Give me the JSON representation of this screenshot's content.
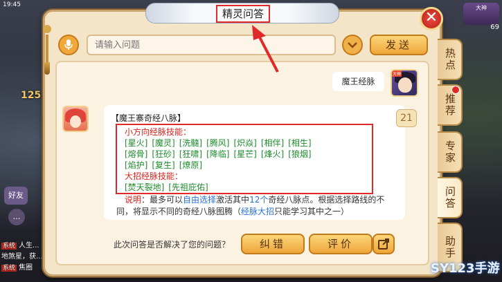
{
  "status": {
    "time": "19:45"
  },
  "background": {
    "left_number": "125",
    "friend_label": "好友",
    "round_icon": "…",
    "chat_lines": [
      {
        "tag": "系统",
        "text": "人生..."
      },
      {
        "tag": "",
        "text": "地煞星，获..."
      },
      {
        "tag": "系统",
        "text": "焦圈"
      }
    ],
    "right_top_label": "大神",
    "right_number": "69"
  },
  "dialog": {
    "title": "精灵问答",
    "close_glyph": "✕",
    "search": {
      "placeholder": "请输入问题",
      "value": ""
    },
    "send_label": "发送",
    "user_question": "魔王经脉",
    "user_avatar_tag": "大神",
    "answer": {
      "title": "【魔王寨奇经八脉】",
      "small_label": "小方向经脉技能：",
      "small_rows": [
        [
          "[星火]",
          "[魔灵]",
          "[洗髓]",
          "[腾风]",
          "[炽焱]",
          "[相伴]",
          "[相生]"
        ],
        [
          "[熔骨]",
          "[狂砂]",
          "[狂啸]",
          "[降临]",
          "[星芒]",
          "[烽火]",
          "[狼烟]"
        ],
        [
          "[焰护]",
          "[复生]",
          "[燎原]"
        ]
      ],
      "big_label": "大招经脉技能：",
      "big_row": [
        "[焚天裂地]",
        "[先祖庇佑]"
      ],
      "note_label": "说明",
      "note_line1_a": "：最多可以",
      "note_line1_hl1": "自由选择",
      "note_line1_b": "激活其中",
      "note_line1_hl2": "12个",
      "note_line1_c": "奇经八脉点。根据选择路线的不",
      "note_line2_a": "同，将显示不同的奇经八脉图腾（",
      "note_line2_hl": "经脉大招",
      "note_line2_b": "只能学习其中之一）"
    },
    "emoji_badge": "21",
    "footer_question": "此次问答是否解决了您的问题？",
    "correct_label": "纠错",
    "rate_label": "评价"
  },
  "side_tabs": [
    {
      "label": "热点"
    },
    {
      "label": "推荐"
    },
    {
      "label": "专家"
    },
    {
      "label": "问答"
    },
    {
      "label": "助手"
    }
  ],
  "watermark": "SY123手游",
  "colors": {
    "accent_red": "#e02a2a",
    "skill_green": "#1c8b2a",
    "button_orange": "#eea53a",
    "panel_bg": "#f4e4c8"
  }
}
